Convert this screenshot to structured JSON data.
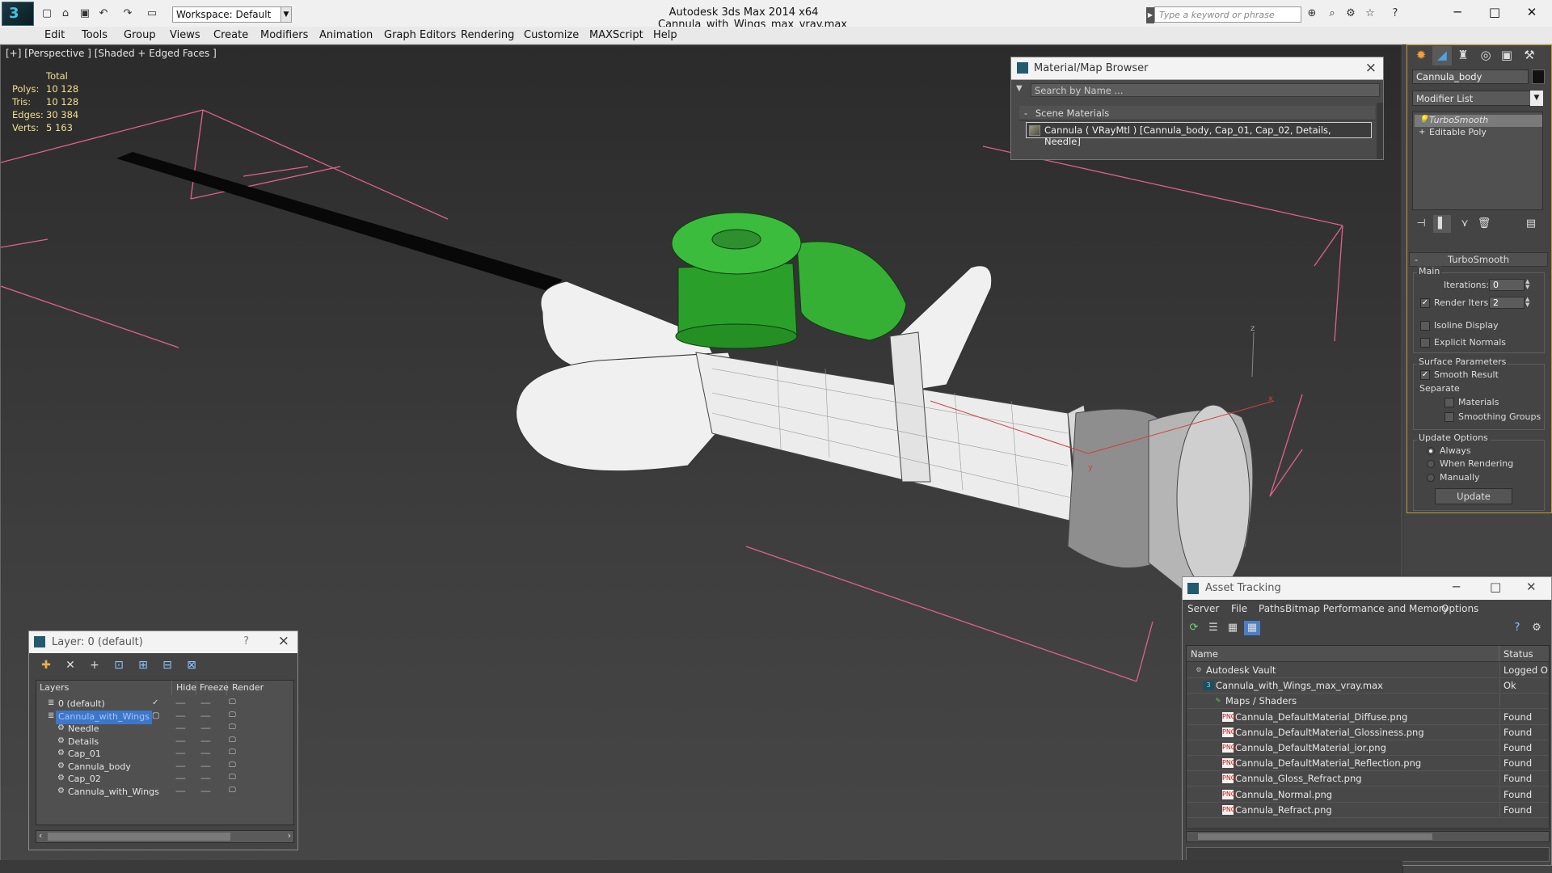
{
  "titlebar": {
    "app_title": "Autodesk 3ds Max  2014 x64",
    "file_name": "Cannula_with_Wings_max_vray.max",
    "workspace": "Workspace: Default",
    "search_placeholder": "Type a keyword or phrase",
    "logo_text": "3"
  },
  "menu": [
    "Edit",
    "Tools",
    "Group",
    "Views",
    "Create",
    "Modifiers",
    "Animation",
    "Graph Editors",
    "Rendering",
    "Customize",
    "MAXScript",
    "Help"
  ],
  "viewport": {
    "label": "[+] [Perspective ] [Shaded + Edged Faces ]",
    "stats": {
      "header": "Total",
      "rows": [
        {
          "label": "Polys:",
          "value": "10 128"
        },
        {
          "label": "Tris:",
          "value": "10 128"
        },
        {
          "label": "Edges:",
          "value": "30 384"
        },
        {
          "label": "Verts:",
          "value": "5 163"
        }
      ]
    },
    "gizmo_labels": {
      "z": "z",
      "x": "x",
      "y": "y"
    }
  },
  "material_browser": {
    "title": "Material/Map Browser",
    "search_placeholder": "Search by Name ...",
    "section": "Scene Materials",
    "item": "Cannula  ( VRayMtl )  [Cannula_body, Cap_01, Cap_02, Details, Needle]"
  },
  "command_panel": {
    "object_name": "Cannula_body",
    "modifier_list": "Modifier List",
    "stack": [
      {
        "label": "TurboSmooth",
        "selected": true
      },
      {
        "label": "Editable Poly",
        "selected": false
      }
    ],
    "rollout_title": "TurboSmooth",
    "main_group": "Main",
    "iterations_label": "Iterations:",
    "iterations_value": "0",
    "render_iters_label": "Render Iters:",
    "render_iters_value": "2",
    "isoline_display": "Isoline Display",
    "explicit_normals": "Explicit Normals",
    "surface_params": "Surface Parameters",
    "smooth_result": "Smooth Result",
    "separate": "Separate",
    "materials": "Materials",
    "smoothing_groups": "Smoothing Groups",
    "update_options": "Update Options",
    "always": "Always",
    "when_rendering": "When Rendering",
    "manually": "Manually",
    "update_button": "Update"
  },
  "layer_window": {
    "title": "Layer: 0 (default)",
    "help": "?",
    "columns": [
      "Layers",
      "Hide",
      "Freeze",
      "Render"
    ],
    "rows": [
      {
        "name": "0 (default)",
        "indent": 1,
        "selected": false
      },
      {
        "name": "Cannula_with_Wings",
        "indent": 1,
        "selected": true
      },
      {
        "name": "Needle",
        "indent": 2,
        "selected": false
      },
      {
        "name": "Details",
        "indent": 2,
        "selected": false
      },
      {
        "name": "Cap_01",
        "indent": 2,
        "selected": false
      },
      {
        "name": "Cannula_body",
        "indent": 2,
        "selected": false
      },
      {
        "name": "Cap_02",
        "indent": 2,
        "selected": false
      },
      {
        "name": "Cannula_with_Wings",
        "indent": 2,
        "selected": false
      }
    ]
  },
  "asset_tracking": {
    "title": "Asset Tracking",
    "menu": [
      "Server",
      "File",
      "Paths",
      "Bitmap Performance and Memory",
      "Options"
    ],
    "columns": [
      "Name",
      "Status"
    ],
    "rows": [
      {
        "name": "Autodesk Vault",
        "status": "Logged Out",
        "level": 1,
        "icon": "vault"
      },
      {
        "name": "Cannula_with_Wings_max_vray.max",
        "status": "Ok",
        "level": 2,
        "icon": "max"
      },
      {
        "name": "Maps / Shaders",
        "status": "",
        "level": 3,
        "icon": "maps"
      },
      {
        "name": "Cannula_DefaultMaterial_Diffuse.png",
        "status": "Found",
        "level": 4,
        "icon": "png"
      },
      {
        "name": "Cannula_DefaultMaterial_Glossiness.png",
        "status": "Found",
        "level": 4,
        "icon": "png"
      },
      {
        "name": "Cannula_DefaultMaterial_ior.png",
        "status": "Found",
        "level": 4,
        "icon": "png"
      },
      {
        "name": "Cannula_DefaultMaterial_Reflection.png",
        "status": "Found",
        "level": 4,
        "icon": "png"
      },
      {
        "name": "Cannula_Gloss_Refract.png",
        "status": "Found",
        "level": 4,
        "icon": "png"
      },
      {
        "name": "Cannula_Normal.png",
        "status": "Found",
        "level": 4,
        "icon": "png"
      },
      {
        "name": "Cannula_Refract.png",
        "status": "Found",
        "level": 4,
        "icon": "png"
      }
    ]
  },
  "colors": {
    "accent": "#c19a2e",
    "selection": "#3d77c9",
    "stats_text": "#f0e08c",
    "model_green": "#2fa82f",
    "grid_lines": "#e05a8c"
  }
}
